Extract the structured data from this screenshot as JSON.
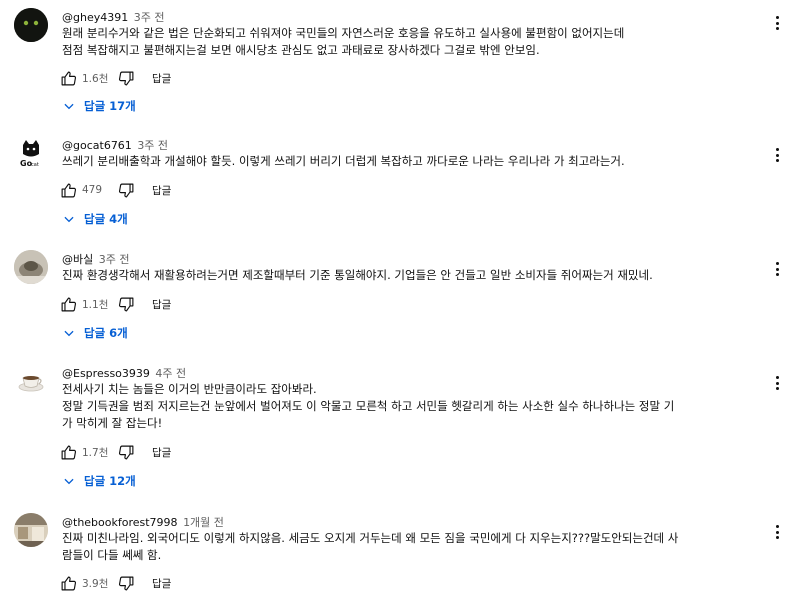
{
  "comments": [
    {
      "author": "@ghey4391",
      "time": "3주 전",
      "lines": [
        "원래 분리수거와 같은 법은 단순화되고 쉬워져야 국민들의 자연스러운 호응을 유도하고 실사용에 불편함이 없어지는데",
        "점점 복잡해지고 불편해지는걸 보면 애시당초 관심도 없고 과태료로 장사하겠다 그걸로 밖엔 안보임."
      ],
      "likes": "1.6천",
      "reply_label": "답글",
      "replies_label": "답글 17개",
      "avatar_icon": "dark-cat-avatar"
    },
    {
      "author": "@gocat6761",
      "time": "3주 전",
      "lines": [
        "쓰레기 분리배출학과 개설해야 할듯.  이렇게 쓰레기 버리기 더럽게 복잡하고 까다로운 나라는 우리나라 가 최고라는거."
      ],
      "likes": "479",
      "reply_label": "답글",
      "replies_label": "답글 4개",
      "avatar_icon": "gocat-logo-avatar",
      "avatar_text": "Go"
    },
    {
      "author": "@바실",
      "time": "3주 전",
      "lines": [
        "진짜 환경생각해서 재활용하려는거면 제조할때부터 기준 통일해야지. 기업들은 안 건들고 일반 소비자들 쥐어짜는거 재밌네."
      ],
      "likes": "1.1천",
      "reply_label": "답글",
      "replies_label": "답글 6개",
      "avatar_icon": "cat-photo-avatar"
    },
    {
      "author": "@Espresso3939",
      "time": "4주 전",
      "lines": [
        "전세사기 치는 놈들은 이거의 반만큼이라도 잡아봐라.",
        "정말 기득권을 범죄 저지르는건 눈앞에서 벌어져도 이 악물고 모른척 하고 서민들 헷갈리게 하는 사소한 실수 하나하나는 정말 기",
        "가 막히게 잘 잡는다!"
      ],
      "likes": "1.7천",
      "reply_label": "답글",
      "replies_label": "답글 12개",
      "avatar_icon": "coffee-cup-avatar"
    },
    {
      "author": "@thebookforest7998",
      "time": "1개월 전",
      "lines": [
        "진짜 미친나라임. 외국어디도 이렇게 하지않음. 세금도 오지게 거두는데 왜 모든 짐을 국민에게 다 지우는지???말도안되는건데 사",
        "람들이 다들 쎄쎄 함."
      ],
      "likes": "3.9천",
      "reply_label": "답글",
      "replies_label": "",
      "avatar_icon": "room-photo-avatar"
    }
  ]
}
